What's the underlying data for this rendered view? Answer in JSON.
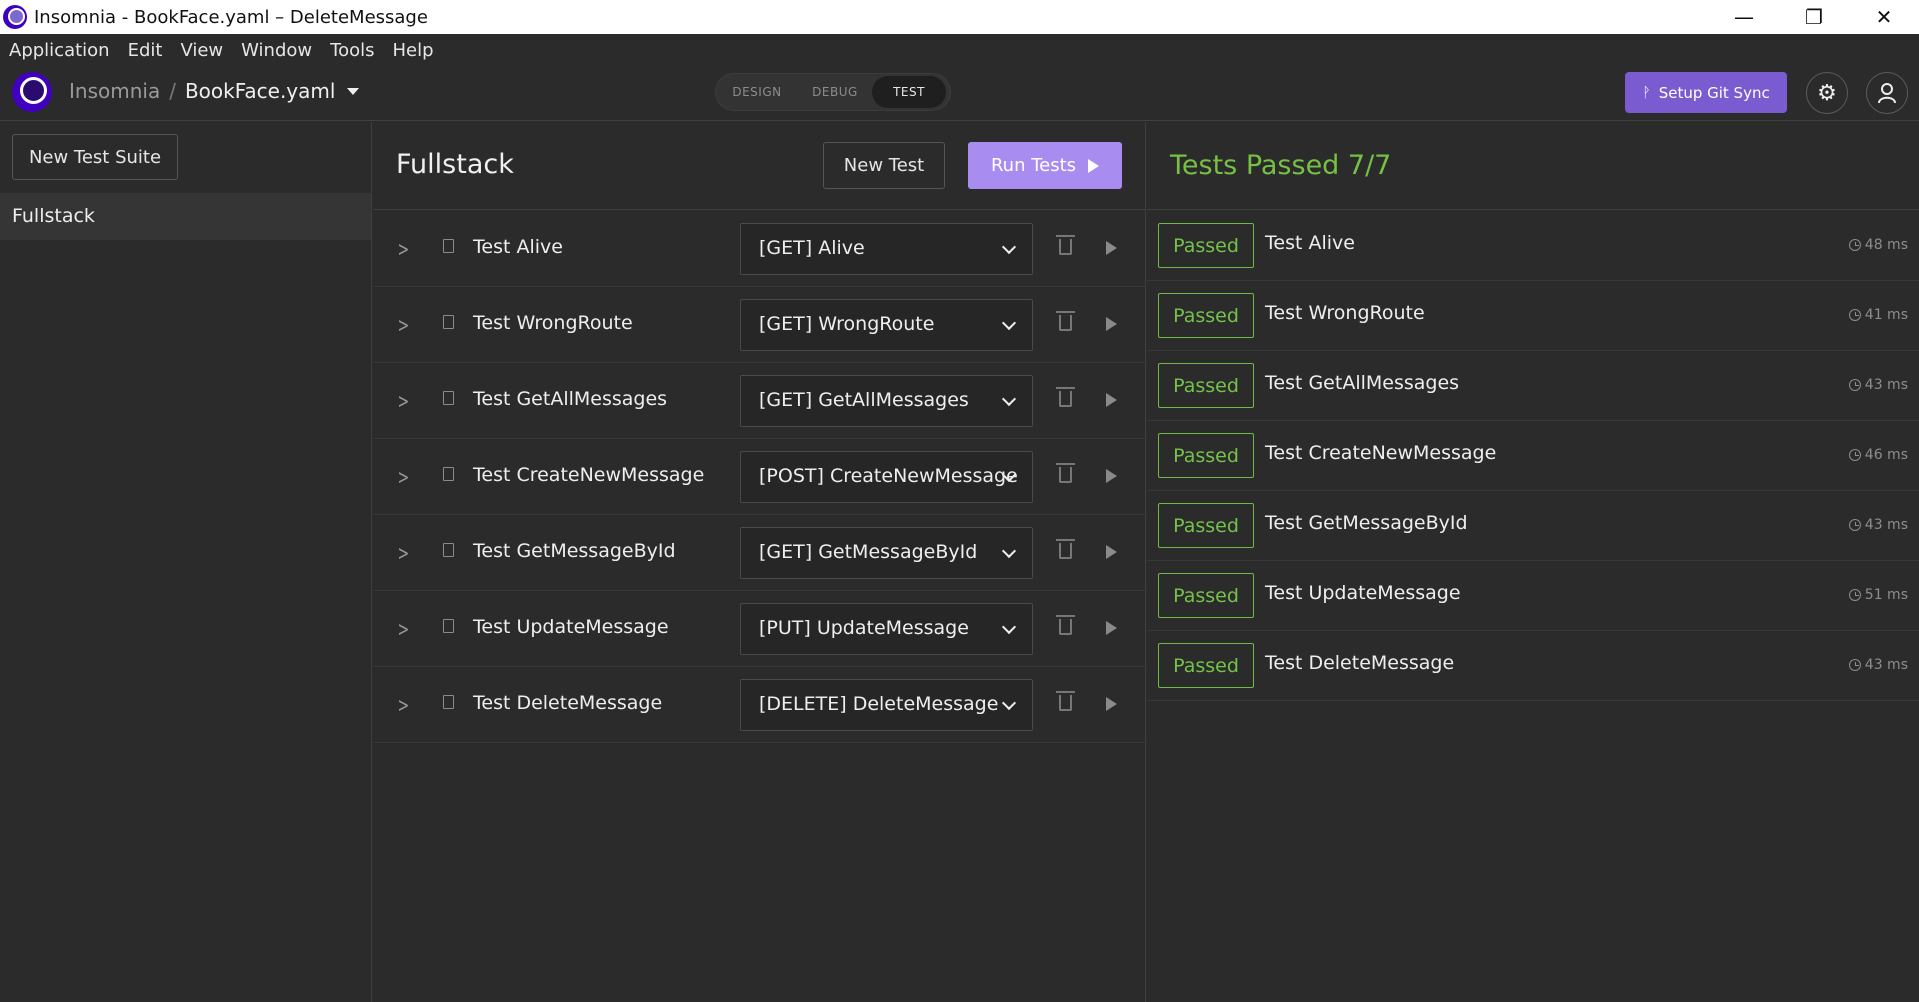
{
  "window": {
    "title": "Insomnia - BookFace.yaml – DeleteMessage",
    "controls": {
      "minimize": "—",
      "restore": "❐",
      "close": "✕"
    }
  },
  "menu": [
    "Application",
    "Edit",
    "View",
    "Window",
    "Tools",
    "Help"
  ],
  "header": {
    "app_name": "Insomnia",
    "separator": "/",
    "file_name": "BookFace.yaml",
    "modes": [
      "DESIGN",
      "DEBUG",
      "TEST"
    ],
    "active_mode": "TEST",
    "git_sync_label": "Setup Git Sync",
    "settings_icon": "gear-icon",
    "account_icon": "user-icon"
  },
  "sidebar": {
    "new_suite_label": "New Test Suite",
    "suites": [
      "Fullstack"
    ]
  },
  "suite": {
    "title": "Fullstack",
    "new_test_label": "New Test",
    "run_tests_label": "Run Tests",
    "tests": [
      {
        "name": "Test Alive",
        "request": "[GET] Alive"
      },
      {
        "name": "Test WrongRoute",
        "request": "[GET] WrongRoute"
      },
      {
        "name": "Test GetAllMessages",
        "request": "[GET] GetAllMessages"
      },
      {
        "name": "Test CreateNewMessage",
        "request": "[POST] CreateNewMessage"
      },
      {
        "name": "Test GetMessageById",
        "request": "[GET] GetMessageById"
      },
      {
        "name": "Test UpdateMessage",
        "request": "[PUT] UpdateMessage"
      },
      {
        "name": "Test DeleteMessage",
        "request": "[DELETE] DeleteMessage"
      }
    ]
  },
  "results": {
    "title": "Tests Passed 7/7",
    "items": [
      {
        "status": "Passed",
        "name": "Test Alive",
        "duration": "48 ms"
      },
      {
        "status": "Passed",
        "name": "Test WrongRoute",
        "duration": "41 ms"
      },
      {
        "status": "Passed",
        "name": "Test GetAllMessages",
        "duration": "43 ms"
      },
      {
        "status": "Passed",
        "name": "Test CreateNewMessage",
        "duration": "46 ms"
      },
      {
        "status": "Passed",
        "name": "Test GetMessageById",
        "duration": "43 ms"
      },
      {
        "status": "Passed",
        "name": "Test UpdateMessage",
        "duration": "51 ms"
      },
      {
        "status": "Passed",
        "name": "Test DeleteMessage",
        "duration": "43 ms"
      }
    ]
  },
  "colors": {
    "accent": "#7a5cd0",
    "run_button": "#a88cf0",
    "pass": "#75c24a",
    "background": "#2b2b2b"
  }
}
